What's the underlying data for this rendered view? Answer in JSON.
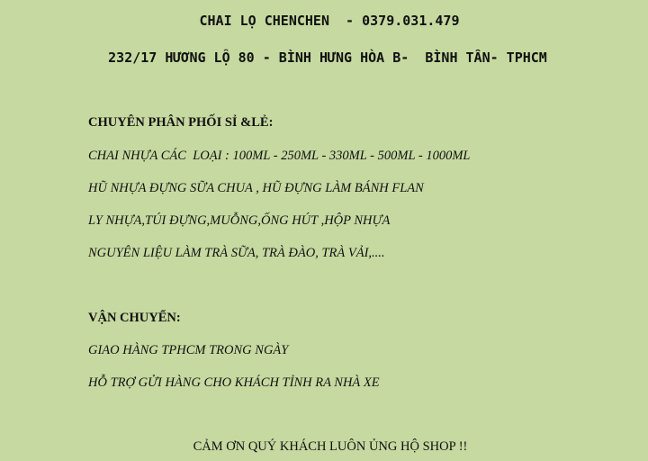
{
  "header": {
    "title": "CHAI LỌ CHENCHEN  - 0379.031.479",
    "address": "232/17 HƯƠNG LỘ 80 - BÌNH HƯNG HÒA B-  BÌNH TÂN- TPHCM"
  },
  "products": {
    "heading": "CHUYÊN PHÂN PHỐI SỈ &LẺ:",
    "items": [
      "CHAI NHỰA CÁC  LOẠI : 100ML - 250ML - 330ML - 500ML - 1000ML",
      "HŨ NHỰA ĐỰNG SỮA CHUA , HŨ ĐỰNG LÀM BÁNH FLAN",
      "LY NHỰA,TÚI ĐỰNG,MUỖNG,ỐNG HÚT ,HỘP NHỰA",
      "NGUYÊN LIỆU LÀM TRÀ SỮA, TRÀ ĐÀO, TRÀ VẢI,...."
    ]
  },
  "shipping": {
    "heading": "VẬN CHUYỂN:",
    "items": [
      "GIAO HÀNG TPHCM TRONG NGÀY",
      "HỖ TRỢ GỬI HÀNG CHO KHÁCH TỈNH RA NHÀ XE"
    ]
  },
  "footer": {
    "thanks": "CẢM ƠN QUÝ KHÁCH LUÔN ỦNG HỘ SHOP !!"
  },
  "colors": {
    "background": "#c6d9a0",
    "text": "#111111"
  }
}
